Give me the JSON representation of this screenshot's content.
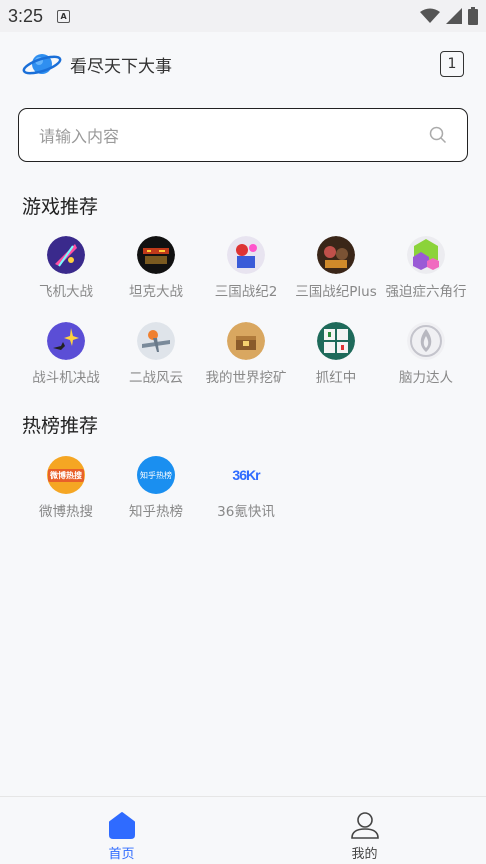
{
  "status_bar": {
    "time": "3:25",
    "sim_label": "A"
  },
  "header": {
    "title": "看尽天下大事",
    "tab_count": "1"
  },
  "search": {
    "placeholder": "请输入内容"
  },
  "sections": {
    "games_title": "游戏推荐",
    "hot_title": "热榜推荐"
  },
  "games": [
    {
      "label": "飞机大战",
      "icon": "plane-battle-icon"
    },
    {
      "label": "坦克大战",
      "icon": "tank-battle-icon"
    },
    {
      "label": "三国战纪2",
      "icon": "three-kingdoms-2-icon"
    },
    {
      "label": "三国战纪Plus",
      "icon": "three-kingdoms-plus-icon"
    },
    {
      "label": "强迫症六角行",
      "icon": "hexagon-puzzle-icon"
    },
    {
      "label": "战斗机决战",
      "icon": "fighter-jet-icon"
    },
    {
      "label": "二战风云",
      "icon": "ww2-icon"
    },
    {
      "label": "我的世界挖矿",
      "icon": "minecraft-mining-icon"
    },
    {
      "label": "抓红中",
      "icon": "mahjong-icon"
    },
    {
      "label": "脑力达人",
      "icon": "brain-master-icon"
    }
  ],
  "hot": [
    {
      "label": "微博热搜",
      "icon": "weibo-hot-icon",
      "badge": "微博热搜"
    },
    {
      "label": "知乎热榜",
      "icon": "zhihu-hot-icon",
      "badge": "知乎热榜"
    },
    {
      "label": "36氪快讯",
      "icon": "36kr-icon",
      "badge": "36Kr"
    }
  ],
  "tabbar": {
    "home": "首页",
    "mine": "我的"
  },
  "colors": {
    "accent": "#2f6bff",
    "label_gray": "#888888"
  }
}
